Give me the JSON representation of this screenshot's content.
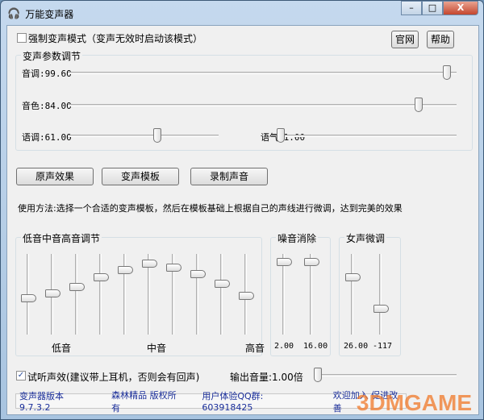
{
  "window": {
    "title": "万能变声器",
    "minimize": "–",
    "maximize": "□",
    "close": "X"
  },
  "top": {
    "force_mode_label": "强制变声模式（变声无效时启动该模式）",
    "force_mode_checked": false,
    "website_button": "官网",
    "help_button": "帮助"
  },
  "params": {
    "legend": "变声参数调节",
    "pitch": {
      "label": "音调:99.60",
      "level": 0.985
    },
    "timbre": {
      "label": "音色:84.00",
      "level": 0.91
    },
    "intonation": {
      "label": "语调:61.00",
      "level": 0.6
    },
    "tone": {
      "label": "语气:1.00",
      "level": 0.0
    }
  },
  "buttons": {
    "original": "原声效果",
    "templates": "变声模板",
    "record": "录制声音"
  },
  "usage": "使用方法:选择一个合适的变声模板，然后在模板基础上根据自己的声线进行微调，达到完美的效果",
  "eq": {
    "legend": "低音中音高音调节",
    "low": "低音",
    "mid": "中音",
    "high": "高音",
    "levels": [
      0.45,
      0.51,
      0.6,
      0.73,
      0.83,
      0.92,
      0.87,
      0.78,
      0.65,
      0.48
    ]
  },
  "noise": {
    "legend": "噪音消除",
    "values": [
      "2.00",
      "16.00"
    ],
    "levels": [
      0.95,
      0.95
    ]
  },
  "female": {
    "legend": "女声微调",
    "values": [
      "26.00",
      "-117"
    ],
    "levels": [
      0.73,
      0.3
    ]
  },
  "preview": {
    "label": "试听声效(建议带上耳机，否则会有回声)",
    "checked": true,
    "check_glyph": "✓"
  },
  "output": {
    "label": "输出音量:1.00倍",
    "level": 0.0
  },
  "status": {
    "version": "变声器版本9.7.3.2",
    "copyright": "森林精品 版权所有",
    "qq": "用户体验QQ群: 603918425",
    "welcome": "欢迎加入 促进改善"
  },
  "watermark": "3DMGAME"
}
